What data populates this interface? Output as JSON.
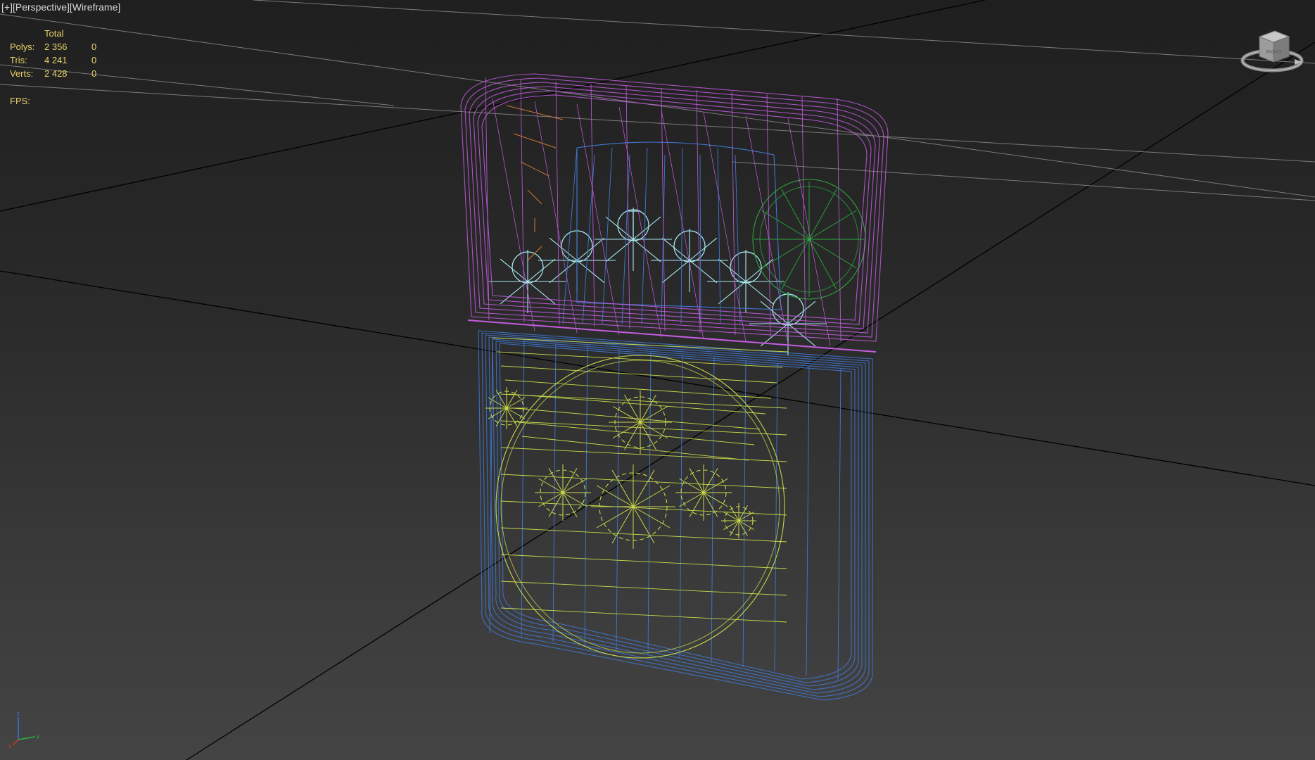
{
  "viewport": {
    "label_plus": "[+]",
    "label_view": "[Perspective]",
    "label_shading": "[Wireframe]"
  },
  "stats": {
    "header": "Total",
    "rows": [
      {
        "label": "Polys:",
        "total": "2 356",
        "selected": "0"
      },
      {
        "label": "Tris:",
        "total": "4 241",
        "selected": "0"
      },
      {
        "label": "Verts:",
        "total": "2 428",
        "selected": "0"
      }
    ],
    "fps_label": "FPS:",
    "text_color": "#e8d26a"
  },
  "viewcube": {
    "icon": "viewcube-icon",
    "face_label": "RIGHT"
  },
  "axis_tripod": {
    "icon": "axis-tripod-icon",
    "x": "x",
    "y": "y",
    "z": "z"
  },
  "wireframe_colors": {
    "lid": "#c45ce0",
    "body": "#3f78d4",
    "emblem": "#c8d84a",
    "insert": "#a8e8f0",
    "wheel": "#2aa83a",
    "chimney": "#d0782a",
    "grid": "#7a7a7a",
    "home_grid_axis": "#000000"
  }
}
